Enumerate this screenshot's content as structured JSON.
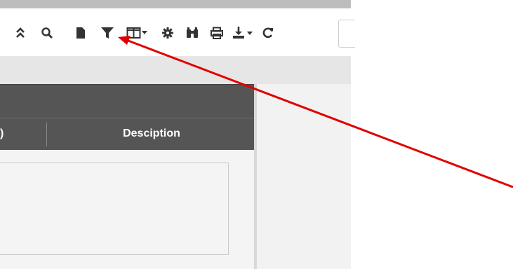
{
  "toolbar": {
    "icons": [
      "collapse-icon",
      "search-icon",
      "document-icon",
      "filter-icon",
      "columns-icon",
      "settings-icon",
      "binoculars-icon",
      "print-icon",
      "download-icon",
      "refresh-icon"
    ]
  },
  "grid": {
    "partial_column_edge": ")",
    "description_header": "Desciption"
  },
  "colors": {
    "header_bg": "#555555",
    "arrow": "#e00000"
  }
}
